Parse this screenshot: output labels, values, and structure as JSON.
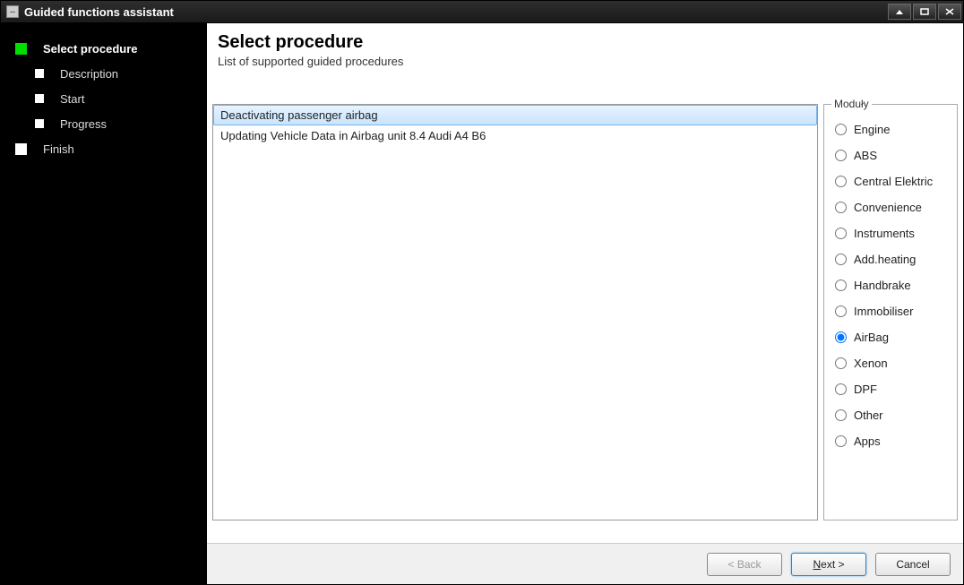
{
  "window": {
    "title": "Guided functions assistant"
  },
  "sidebar": {
    "steps": [
      {
        "label": "Select procedure",
        "active": true
      },
      {
        "label": "Description",
        "active": false
      },
      {
        "label": "Start",
        "active": false
      },
      {
        "label": "Progress",
        "active": false
      },
      {
        "label": "Finish",
        "active": false
      }
    ]
  },
  "main": {
    "heading": "Select procedure",
    "subtitle": "List of supported guided procedures",
    "procedures": [
      {
        "label": "Deactivating passenger airbag",
        "selected": true
      },
      {
        "label": "Updating Vehicle Data in Airbag unit 8.4 Audi A4 B6",
        "selected": false
      }
    ]
  },
  "modules": {
    "legend": "Moduły",
    "items": [
      {
        "label": "Engine",
        "checked": false
      },
      {
        "label": "ABS",
        "checked": false
      },
      {
        "label": "Central Elektric",
        "checked": false
      },
      {
        "label": "Convenience",
        "checked": false
      },
      {
        "label": "Instruments",
        "checked": false
      },
      {
        "label": "Add.heating",
        "checked": false
      },
      {
        "label": "Handbrake",
        "checked": false
      },
      {
        "label": "Immobiliser",
        "checked": false
      },
      {
        "label": "AirBag",
        "checked": true
      },
      {
        "label": "Xenon",
        "checked": false
      },
      {
        "label": "DPF",
        "checked": false
      },
      {
        "label": "Other",
        "checked": false
      },
      {
        "label": "Apps",
        "checked": false
      }
    ]
  },
  "footer": {
    "back": "< Back",
    "next_prefix": "N",
    "next_suffix": "ext >",
    "cancel": "Cancel"
  }
}
